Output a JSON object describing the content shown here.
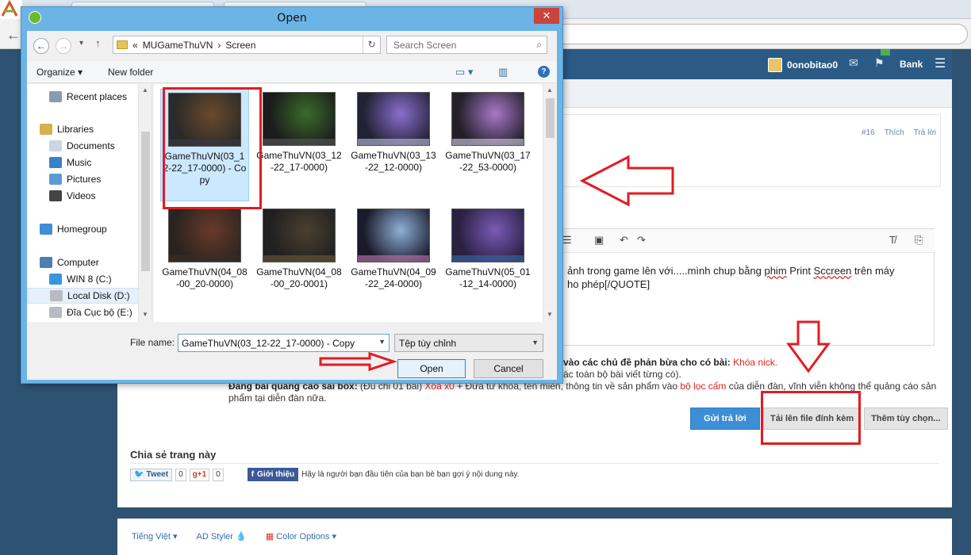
{
  "dialog": {
    "title": "Open",
    "close_glyph": "✕",
    "breadcrumb": {
      "prefix": "«",
      "parts": [
        "MUGameThuVN",
        "Screen"
      ],
      "separator": "›"
    },
    "search_placeholder": "Search Screen",
    "toolbar": {
      "organize": "Organize",
      "new_folder": "New folder"
    },
    "nav": [
      {
        "label": "Recent places",
        "icon": "recent-places-icon",
        "color": "#8a9bb0"
      },
      {
        "label": "Libraries",
        "icon": "libraries-icon",
        "color": "#d8b04c"
      },
      {
        "label": "Documents",
        "icon": "documents-icon",
        "color": "#c9d6e6"
      },
      {
        "label": "Music",
        "icon": "music-icon",
        "color": "#3a7fc9"
      },
      {
        "label": "Pictures",
        "icon": "pictures-icon",
        "color": "#5c9ad6"
      },
      {
        "label": "Videos",
        "icon": "videos-icon",
        "color": "#444"
      },
      {
        "label": "Homegroup",
        "icon": "homegroup-icon",
        "color": "#3f8fd2"
      },
      {
        "label": "Computer",
        "icon": "computer-icon",
        "color": "#4a7fb0"
      },
      {
        "label": "WIN 8 (C:)",
        "icon": "windows-drive-icon",
        "color": "#3a95e0"
      },
      {
        "label": "Local Disk (D:)",
        "icon": "drive-icon",
        "color": "#b8bcc2"
      },
      {
        "label": "Đĩa Cục bộ (E:)",
        "icon": "drive-icon",
        "color": "#b8bcc2"
      }
    ],
    "files": [
      {
        "name": "GameThuVN(03_12-22_17-0000) - Copy",
        "selected": true
      },
      {
        "name": "GameThuVN(03_12-22_17-0000)"
      },
      {
        "name": "GameThuVN(03_13-22_12-0000)"
      },
      {
        "name": "GameThuVN(03_17-22_53-0000)"
      },
      {
        "name": "GameThuVN(04_08-00_20-0000)"
      },
      {
        "name": "GameThuVN(04_08-00_20-0001)"
      },
      {
        "name": "GameThuVN(04_09-22_24-0000)"
      },
      {
        "name": "GameThuVN(05_01-12_14-0000)"
      }
    ],
    "file_name_label": "File name:",
    "file_name_value": "GameThuVN(03_12-22_17-0000) - Copy",
    "file_type": "Tệp tùy chỉnh",
    "open_label": "Open",
    "cancel_label": "Cancel"
  },
  "forum": {
    "username": "0onobitao0",
    "bank": "Bank",
    "post_number": "#16",
    "like": "Thích",
    "reply": "Trả lời",
    "editor_line1_a": "ảnh trong game lên với.....mình chup bằng ",
    "editor_line1_spell": "phim",
    "editor_line1_b": " Print ",
    "editor_line1_spell2": "Sccreen",
    "editor_line1_c": " trên máy",
    "editor_line2": "ho phép[/QUOTE]",
    "rule1_a": "vào các chủ đề phản bừa cho có bài: ",
    "rule1_red": "Khóa nick.",
    "rule2": "ác toàn bộ bài viết từng có).",
    "rule3_bold": "Đăng bài ",
    "rule3_red1": "quảng cáo",
    "rule3_bold2": " sai box:",
    "rule3_a": " (Đủ chỉ 01 bài) ",
    "rule3_red2": "Xóa x0",
    "rule3_b": " + Đưa từ khóa, tên miền, thông tin về sản phẩm vào ",
    "rule3_red3": "bộ lọc cấm",
    "rule3_c": " của diễn đàn, vĩnh viễn không thể quảng cáo sản",
    "rule3_d": "phẩm tại diễn đàn nữa.",
    "reply_button": "Gửi trả lời",
    "upload_button": "Tải lên file đính kèm",
    "more_options": "Thêm tùy chọn...",
    "share_title": "Chia sẻ trang này",
    "tweet": "Tweet",
    "tweet_count": "0",
    "gplus": "g+1",
    "gplus_count": "0",
    "fb_button": "Giới thiệu",
    "fb_text": "Hãy là người bạn đầu tiên của bạn bè bạn gợi ý nội dung này.",
    "footer": [
      "Tiếng Việt ▾",
      "AD Styler 💧",
      "Color Options ▾"
    ]
  },
  "colors": {
    "annotation": "#e31b23",
    "accent": "#3c8fd6",
    "header": "#2b5a85"
  }
}
